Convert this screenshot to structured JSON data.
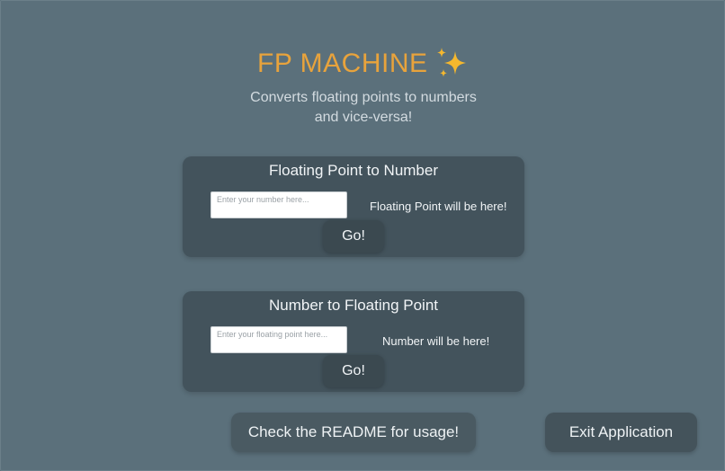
{
  "app": {
    "title": "FP MACHINE",
    "title_icon": "sparkles-icon",
    "subtitle_line1": "Converts floating points to numbers",
    "subtitle_line2": "and vice-versa!"
  },
  "colors": {
    "background": "#5b707b",
    "card": "#43535c",
    "title_accent": "#e8a33c",
    "sparkle": "#f5b82e"
  },
  "fp_to_number": {
    "title": "Floating Point to Number",
    "input_value": "",
    "input_placeholder": "Enter your number here...",
    "output_text": "Floating Point will be here!",
    "go_label": "Go!"
  },
  "number_to_fp": {
    "title": "Number to Floating Point",
    "input_value": "",
    "input_placeholder": "Enter your floating point here...",
    "output_text": "Number will be here!",
    "go_label": "Go!"
  },
  "footer": {
    "readme_label": "Check the README for usage!",
    "exit_label": "Exit Application"
  }
}
